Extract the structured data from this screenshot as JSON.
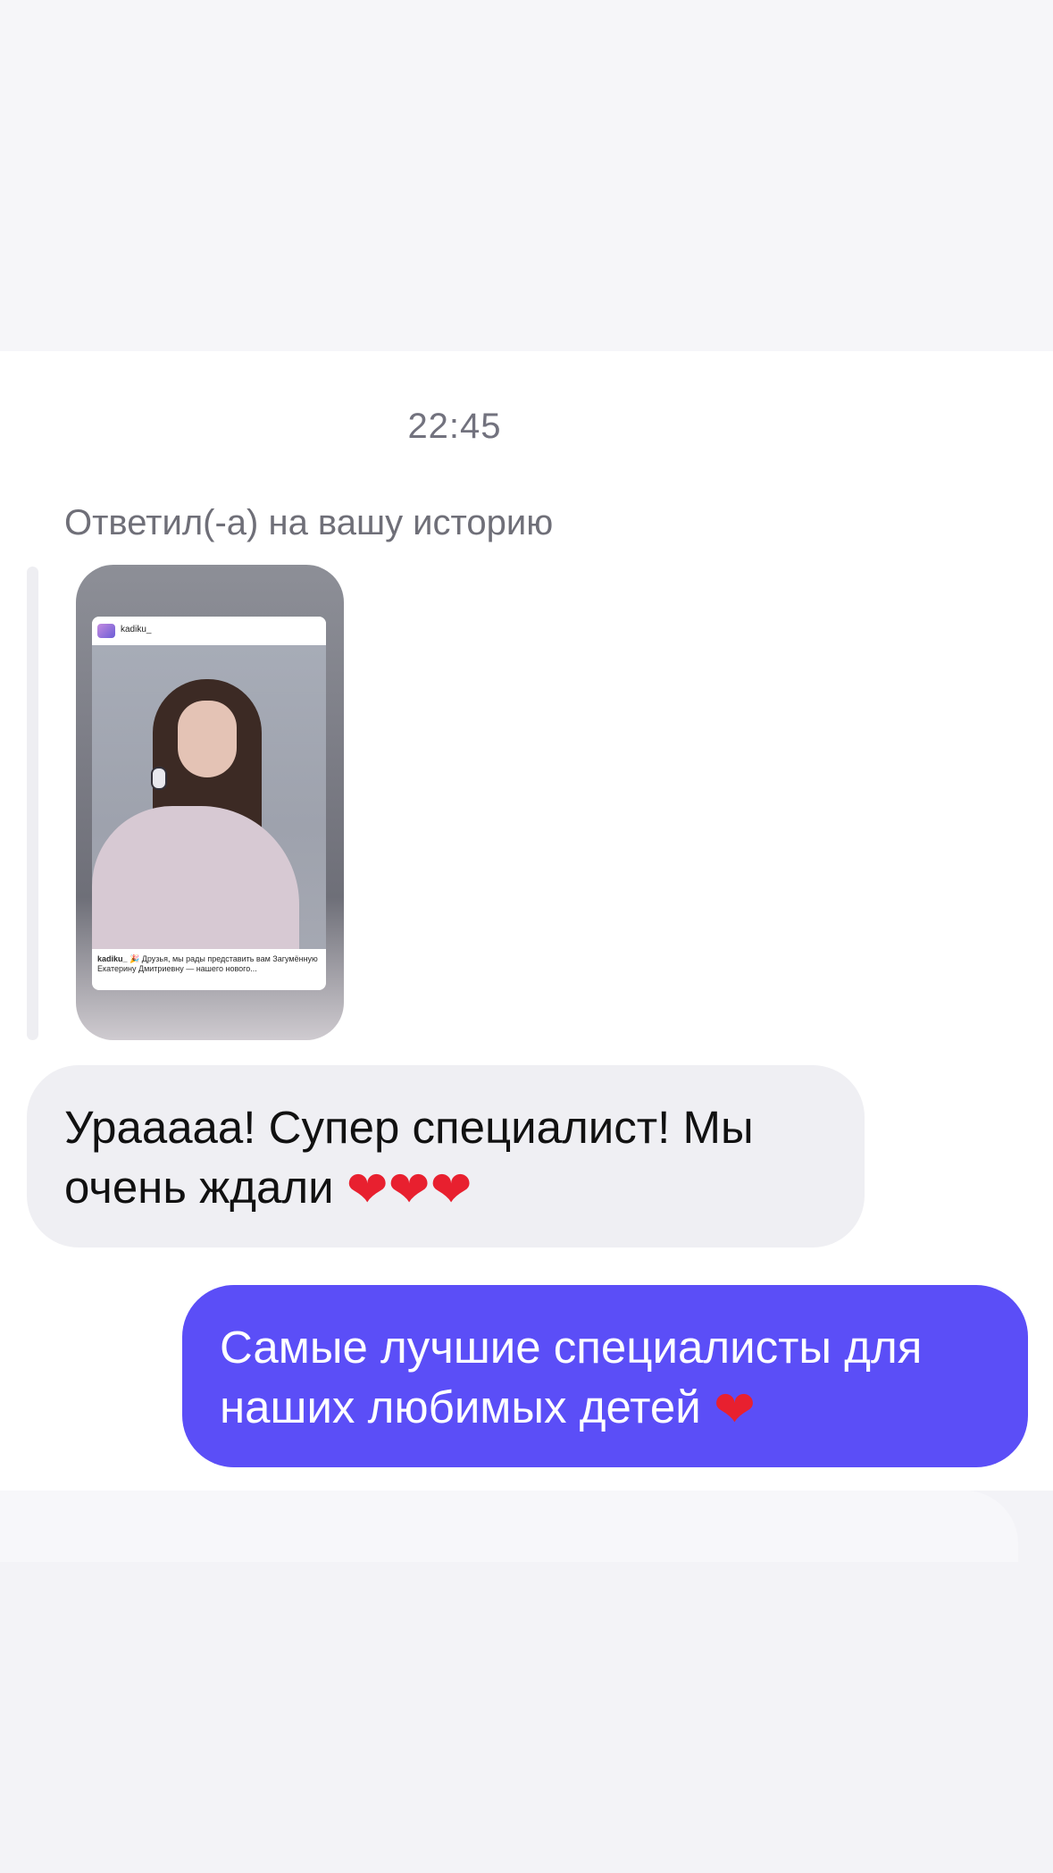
{
  "chat": {
    "timestamp": "22:45",
    "reply_label": "Ответил(-а) на вашу историю",
    "story": {
      "username": "kadiku_",
      "caption_user": "kadiku_",
      "caption_text": "🎉 Друзья, мы рады представить вам Загумённую Екатерину Дмитриевну — нашего нового..."
    },
    "incoming_message": {
      "text": "Урааааа! Супер специалист! Мы очень ждали",
      "emoji": "❤❤❤"
    },
    "outgoing_message": {
      "text": "Самые лучшие специалисты для наших любимых детей",
      "emoji": "❤"
    }
  },
  "colors": {
    "outgoing_bubble": "#5b4ef7",
    "incoming_bubble": "#efeff3",
    "heart": "#e8202f"
  },
  "icons": {
    "heart": "red-heart-emoji"
  }
}
